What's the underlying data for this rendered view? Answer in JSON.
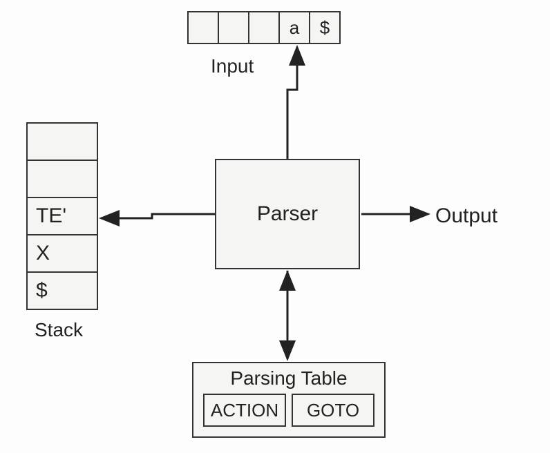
{
  "input": {
    "label": "Input",
    "cells": [
      "",
      "",
      "",
      "a",
      "$"
    ]
  },
  "stack": {
    "label": "Stack",
    "cells": [
      "",
      "",
      "TE'",
      "X",
      "$"
    ]
  },
  "parser": {
    "label": "Parser"
  },
  "output": {
    "label": "Output"
  },
  "parsing_table": {
    "title": "Parsing Table",
    "action": "ACTION",
    "goto": "GOTO"
  }
}
